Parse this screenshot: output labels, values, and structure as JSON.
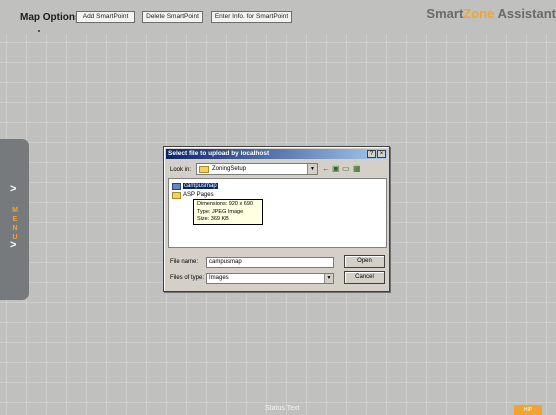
{
  "toolbar": {
    "label": "Map Options:",
    "add_label": "Add SmartPoint",
    "delete_label": "Delete SmartPoint",
    "enter_info_label": "Enter Info. for SmartPoint"
  },
  "brand": {
    "part1": "Smart",
    "part2": "Zone",
    "part3": " Assistant"
  },
  "side_panel": {
    "menu_letters": [
      "M",
      "E",
      "N",
      "U"
    ],
    "arrow_glyph": ">"
  },
  "dialog": {
    "title": "Select file to upload by localhost",
    "help_glyph": "?",
    "close_glyph": "×",
    "look_in_label": "Look in:",
    "look_in_value": "ZoningSetup",
    "files": [
      {
        "name": "campusmap",
        "type": "image",
        "selected": true
      },
      {
        "name": "ASP Pages",
        "type": "folder",
        "selected": false
      }
    ],
    "tooltip": {
      "dimensions": "Dimensions: 920 x 690",
      "type": "Type: JPEG Image",
      "size": "Size: 369 KB"
    },
    "file_name_label": "File name:",
    "file_name_value": "campusmap",
    "file_type_label": "Files of type:",
    "file_type_value": "Images",
    "open_label": "Open",
    "cancel_label": "Cancel",
    "icons": [
      "back-arrow-icon",
      "up-folder-icon",
      "new-folder-icon",
      "view-menu-icon"
    ]
  },
  "status": {
    "text": "Status Text"
  },
  "corner_button": {
    "label": "HIP"
  }
}
